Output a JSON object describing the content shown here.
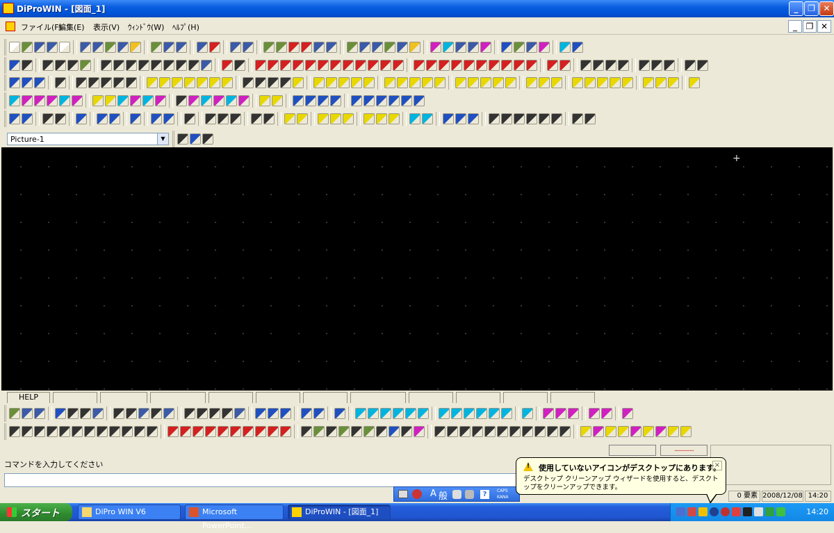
{
  "window": {
    "title": "DiProWIN - [図面_1]"
  },
  "window_buttons": {
    "minimize": "_",
    "restore": "❐",
    "close": "✕"
  },
  "menu": {
    "items": [
      {
        "label": "ファイル(F)"
      },
      {
        "label": "編集(E)"
      },
      {
        "label": "表示(V)"
      },
      {
        "label": "ｳｨﾝﾄﾞｳ(W)"
      },
      {
        "label": "ﾍﾙﾌﾟ(H)"
      }
    ]
  },
  "picture_select": {
    "value": "Picture-1"
  },
  "help_tab": {
    "label": "HELP"
  },
  "command": {
    "label": "コマンドを入力してください",
    "value": ""
  },
  "status": {
    "count": "0 要素",
    "date": "2008/12/08",
    "time": "14:20",
    "marker": "..............."
  },
  "balloon": {
    "title": "使用していないアイコンがデスクトップにあります。",
    "body": "デスクトップ クリーンアップ ウィザードを使用すると、デスクトップをクリーンアップできます。",
    "close": "×"
  },
  "langbar": {
    "mode": "A",
    "kanji": "般",
    "caps": "CAPS",
    "kana": "KANA"
  },
  "taskbar": {
    "start": "スタート",
    "tasks": [
      {
        "label": "DiPro WIN V6"
      },
      {
        "label": "Microsoft PowerPoint..."
      },
      {
        "label": "DiProWIN - [図面_1]"
      }
    ],
    "clock": "14:20"
  },
  "canvas": {
    "cursor": "+"
  }
}
